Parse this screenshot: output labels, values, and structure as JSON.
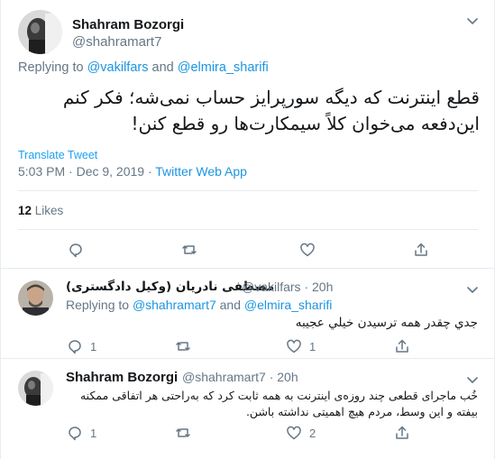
{
  "main_tweet": {
    "author_name": "Shahram Bozorgi",
    "author_handle": "@shahramart7",
    "replying_prefix": "Replying to",
    "reply_mention_1": "@vakilfars",
    "reply_and": "and",
    "reply_mention_2": "@elmira_sharifi",
    "text_line_1": "قطع اینترنت که دیگه سورپرایز حساب نمی‌شه؛ فکر کنم",
    "text_line_2": "این‌دفعه می‌خوان کلاً سیمکارت‌ها رو قطع کنن!",
    "translate_label": "Translate Tweet",
    "timestamp": "5:03 PM · Dec 9, 2019 · ",
    "source": "Twitter Web App",
    "likes_count": "12",
    "likes_label": "Likes"
  },
  "reply_1": {
    "author_name": "مصطفی نادریان (وکیل دادگستری)",
    "author_handle": "@vakilfars · 20h",
    "replying_prefix": "Replying to",
    "reply_mention_1": "@shahramart7",
    "reply_and": "and",
    "reply_mention_2": "@elmira_sharifi",
    "text": "جدي چقدر همه ترسيدن خيلي عجيبه",
    "reply_count": "1",
    "retweet_count": "",
    "like_count": "1"
  },
  "reply_2": {
    "author_name": "Shahram Bozorgi",
    "author_handle": "@shahramart7 · 20h",
    "text_line_1": "خُب ماجرای قطعی چند روزه‌ی اینترنت به همه ثابت کرد که به‌راحتی هر اتفاقی ممکنه",
    "text_line_2": "بیفته و این وسط، مردم هیچ اهمیتی نداشته باشن.",
    "reply_count": "1",
    "retweet_count": "",
    "like_count": "2"
  },
  "colors": {
    "link": "#1b95e0",
    "secondary_text": "#657786",
    "border": "#e6ecf0"
  },
  "icons": [
    "chevron-down-icon",
    "reply-icon",
    "retweet-icon",
    "like-icon",
    "share-icon"
  ]
}
